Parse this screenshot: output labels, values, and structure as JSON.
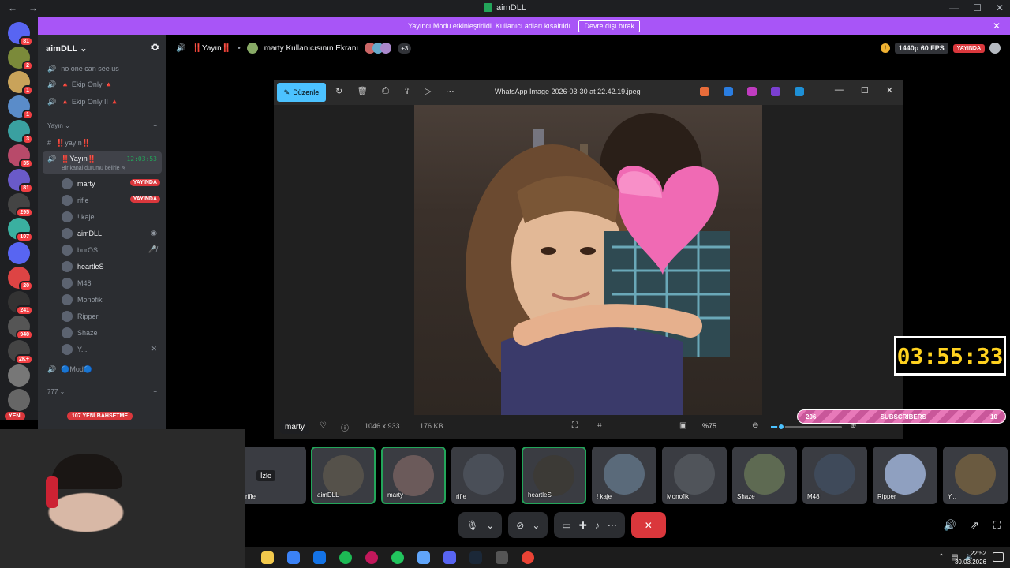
{
  "window": {
    "title": "aimDLL",
    "nav_back": "←",
    "nav_forward": "→",
    "controls": [
      "—",
      "☐",
      "✕"
    ]
  },
  "banner": {
    "message": "Yayıncı Modu etkinleştirildi. Kullanıcı adları kısaltıldı.",
    "button_label": "Devre dışı bırak",
    "close": "✕"
  },
  "servers": [
    {
      "badge": "81"
    },
    {
      "badge": "2"
    },
    {
      "badge": "1"
    },
    {
      "badge": "1"
    },
    {
      "badge": "3"
    },
    {
      "badge": "35"
    },
    {
      "badge": "81"
    },
    {
      "badge": "295"
    },
    {
      "badge": "107"
    },
    {
      "badge": ""
    },
    {
      "badge": "20"
    },
    {
      "badge": "241"
    },
    {
      "badge": "940"
    },
    {
      "badge": "2K+"
    },
    {
      "badge": ""
    },
    {
      "badge": ""
    }
  ],
  "sidebar": {
    "server_name": "aimDLL ⌄",
    "channels_top": [
      {
        "label": "no one can see us"
      },
      {
        "label": "🔺 Ekip Only 🔺"
      },
      {
        "label": "🔺 Ekip Only II 🔺"
      }
    ],
    "category": "Yayın ⌄",
    "text_channel": "‼️yayın‼️",
    "voice_channel": {
      "label": "‼️Yayın‼️",
      "time": "12:03:53",
      "status": "Bir kanal durumu belirle ✎"
    },
    "users": [
      {
        "name": "marty",
        "live": "YAYINDA",
        "bright": true,
        "icon": ""
      },
      {
        "name": "rifle",
        "live": "YAYINDA",
        "bright": false,
        "icon": ""
      },
      {
        "name": "! kaje",
        "live": "",
        "bright": false,
        "icon": ""
      },
      {
        "name": "aimDLL",
        "live": "",
        "bright": true,
        "icon": "◉"
      },
      {
        "name": "burOS",
        "live": "",
        "bright": false,
        "icon": "🎤̸"
      },
      {
        "name": "heartleS",
        "live": "",
        "bright": true,
        "icon": ""
      },
      {
        "name": "M48",
        "live": "",
        "bright": false,
        "icon": ""
      },
      {
        "name": "Monofik",
        "live": "",
        "bright": false,
        "icon": ""
      },
      {
        "name": "Ripper",
        "live": "",
        "bright": false,
        "icon": ""
      },
      {
        "name": "Shaze",
        "live": "",
        "bright": false,
        "icon": ""
      },
      {
        "name": "Y...",
        "live": "",
        "bright": false,
        "icon": "✕"
      }
    ],
    "mod_channel": "🔵Mod🔵",
    "category2": "777 ⌄",
    "new_pill": "YENİ",
    "mention_pill": "107 YENİ BAHSETME"
  },
  "stage": {
    "channel": "‼️Yayın‼️",
    "screen_title": "marty Kullanıcısının Ekranı",
    "more": "+3",
    "quality": "1440p 60 FPS",
    "live": "YAYINDA",
    "warn": "!"
  },
  "viewer": {
    "edit_label": "Düzenle",
    "file_title": "WhatsApp Image 2026-03-30 at 22.42.19.jpeg",
    "dims": "1046 x 933",
    "size": "176 KB",
    "zoom": "%75",
    "user_label": "marty"
  },
  "overlay": {
    "timer": "03:55:33",
    "subs_current": "206",
    "subs_label": "SUBSCRIBERS",
    "subs_goal": "10"
  },
  "tiles": [
    {
      "name": "rifle",
      "speaking": false
    },
    {
      "name": "aimDLL",
      "speaking": true
    },
    {
      "name": "marty",
      "speaking": true
    },
    {
      "name": "rifle",
      "speaking": false
    },
    {
      "name": "heartleS",
      "speaking": true
    },
    {
      "name": "! kaje",
      "speaking": false
    },
    {
      "name": "Monofik",
      "speaking": false
    },
    {
      "name": "Shaze",
      "speaking": false
    },
    {
      "name": "M48",
      "speaking": false
    },
    {
      "name": "Ripper",
      "speaking": false
    },
    {
      "name": "Y...",
      "speaking": false
    }
  ],
  "tile_watch": "İzle",
  "taskbar": {
    "time": "22:52",
    "date": "30.03.2026"
  },
  "colors": {
    "accent": "#5865f2",
    "live": "#da373c",
    "speaking": "#23a55a",
    "banner": "#a855f7",
    "timer": "#ffd21f"
  }
}
